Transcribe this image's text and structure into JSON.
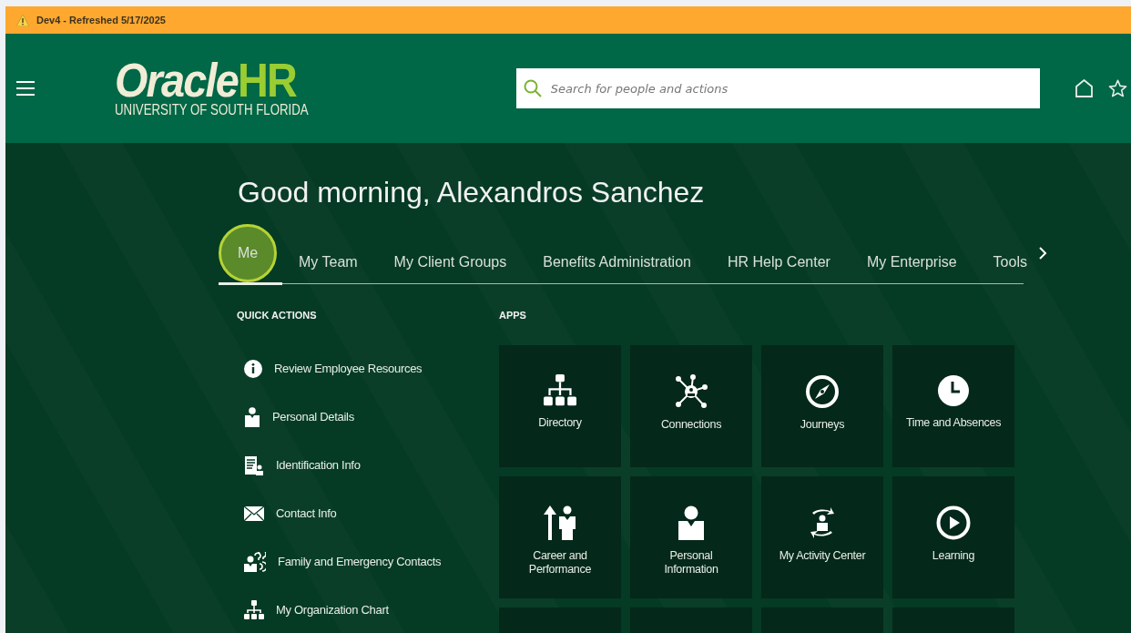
{
  "banner": {
    "text": "Dev4 - Refreshed 5/17/2025"
  },
  "logo": {
    "name": "Oracle",
    "accent": "HR",
    "subtitle": "UNIVERSITY OF SOUTH FLORIDA"
  },
  "search": {
    "placeholder": "Search for people and actions"
  },
  "greeting": "Good morning, Alexandros Sanchez",
  "tabs": [
    {
      "label": "Me",
      "selected": true
    },
    {
      "label": "My Team",
      "selected": false
    },
    {
      "label": "My Client Groups",
      "selected": false
    },
    {
      "label": "Benefits Administration",
      "selected": false
    },
    {
      "label": "HR Help Center",
      "selected": false
    },
    {
      "label": "My Enterprise",
      "selected": false
    },
    {
      "label": "Tools",
      "selected": false
    }
  ],
  "quick_actions": {
    "title": "QUICK ACTIONS",
    "items": [
      {
        "label": "Review Employee Resources"
      },
      {
        "label": "Personal Details"
      },
      {
        "label": "Identification Info"
      },
      {
        "label": "Contact Info"
      },
      {
        "label": "Family and Emergency Contacts"
      },
      {
        "label": "My Organization Chart"
      }
    ]
  },
  "apps": {
    "title": "APPS",
    "tiles": [
      {
        "label": "Directory"
      },
      {
        "label": "Connections"
      },
      {
        "label": "Journeys"
      },
      {
        "label": "Time and Absences"
      },
      {
        "label": "Career and Performance"
      },
      {
        "label": "Personal Information"
      },
      {
        "label": "My Activity Center"
      },
      {
        "label": "Learning"
      }
    ]
  }
}
